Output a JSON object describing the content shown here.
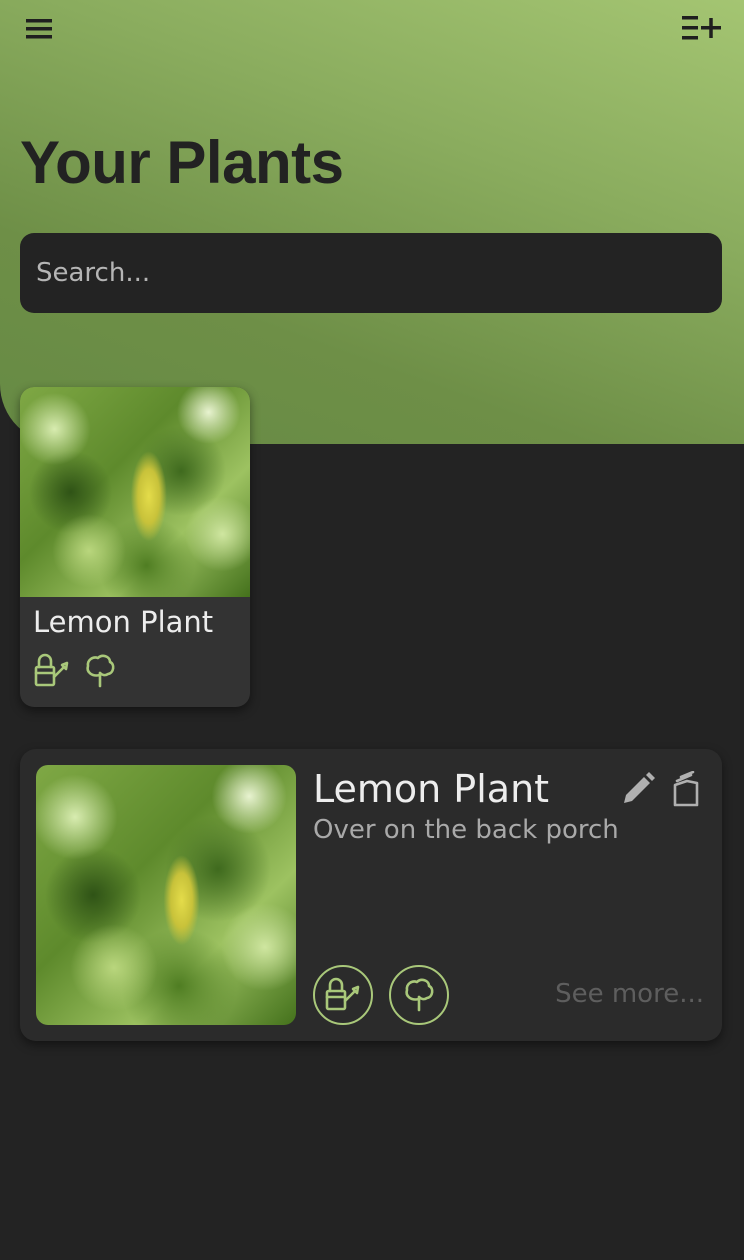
{
  "header": {
    "menu_icon": "hamburger-menu-icon",
    "add_icon": "playlist-add-icon",
    "title": "Your Plants"
  },
  "search": {
    "placeholder": "Search...",
    "value": ""
  },
  "colors": {
    "accent": "#a9c87a",
    "hero_gradient_light": "#a4c572",
    "hero_gradient_dark": "#668a44",
    "background": "#232323",
    "card": "#2b2b2b"
  },
  "grid_card": {
    "name": "Lemon Plant",
    "image": "lemon-plant-photo",
    "icons": [
      "watering-can-icon",
      "tree-icon"
    ]
  },
  "list_card": {
    "name": "Lemon Plant",
    "location": "Over on the back porch",
    "image": "lemon-plant-photo",
    "edit_icon": "pencil-icon",
    "delete_icon": "delete-icon",
    "action_icons": [
      "watering-can-icon",
      "tree-icon"
    ],
    "see_more": "See more..."
  }
}
